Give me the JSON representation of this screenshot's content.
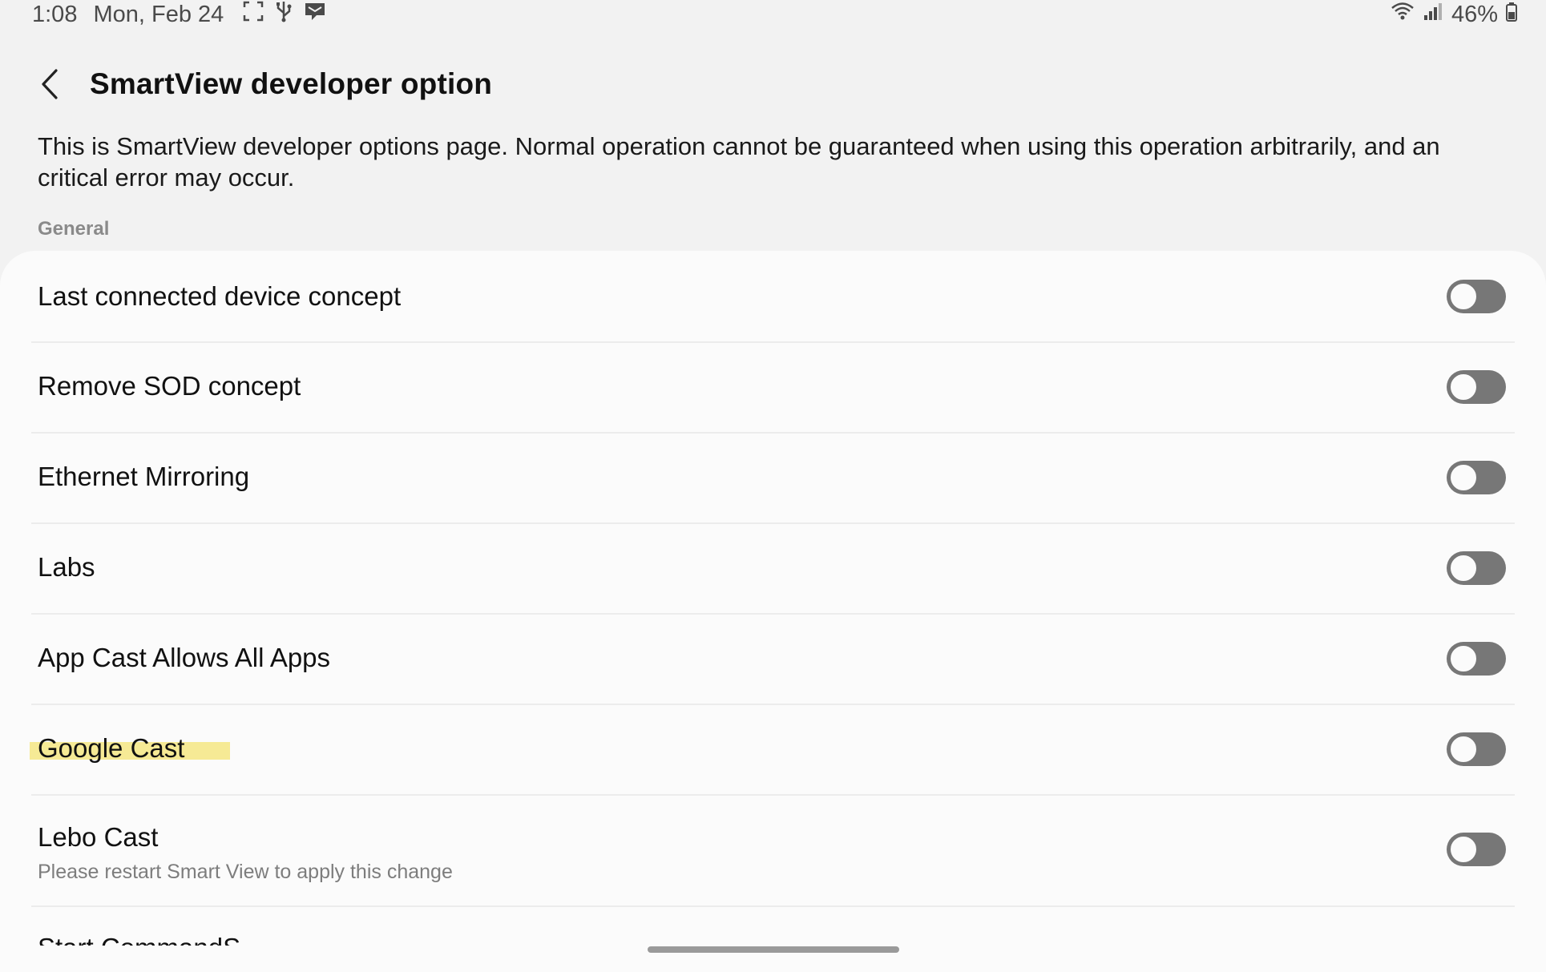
{
  "status_bar": {
    "time": "1:08",
    "date": "Mon, Feb 24",
    "battery": "46%",
    "wifi_icon": "wifi-icon",
    "signal_icon": "cellular-signal-icon"
  },
  "header": {
    "title": "SmartView developer option",
    "back_icon": "back-arrow-icon"
  },
  "description": "This is SmartView developer options page. Normal operation cannot be guaranteed when using this operation arbitrarily, and an critical error may occur.",
  "section": {
    "label": "General"
  },
  "settings": [
    {
      "title": "Last connected device concept",
      "enabled": false
    },
    {
      "title": "Remove SOD concept",
      "enabled": false
    },
    {
      "title": "Ethernet Mirroring",
      "enabled": false
    },
    {
      "title": "Labs",
      "enabled": false
    },
    {
      "title": "App Cast Allows All Apps",
      "enabled": false
    },
    {
      "title": "Google Cast",
      "enabled": false,
      "highlighted": true
    },
    {
      "title": "Lebo Cast",
      "subtitle": "Please restart Smart View to apply this change",
      "enabled": false
    }
  ],
  "partial_item": "Start CommandS",
  "colors": {
    "background": "#f2f2f2",
    "card": "#fbfbfb",
    "toggle_off": "#777777",
    "highlight": "#f6ea95"
  }
}
